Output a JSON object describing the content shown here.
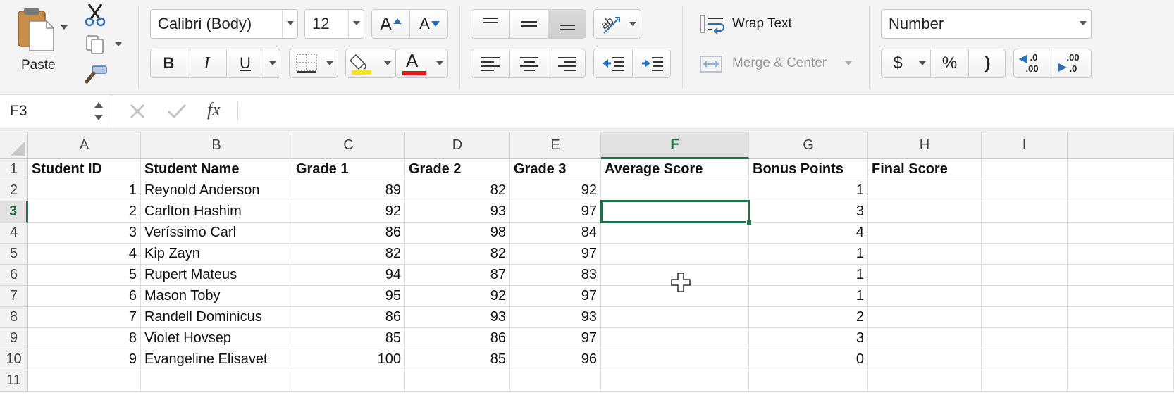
{
  "ribbon": {
    "clipboard": {
      "paste_label": "Paste"
    },
    "font": {
      "font_name": "Calibri (Body)",
      "font_size": "12",
      "bold_glyph": "B",
      "italic_glyph": "I",
      "underline_glyph": "U",
      "font_color_glyph": "A",
      "increase_size_glyph": "A",
      "decrease_size_glyph": "A",
      "fill_color": "#f5e61b",
      "font_color": "#e8161b"
    },
    "alignment": {
      "wrap_text_label": "Wrap Text",
      "merge_center_label": "Merge & Center"
    },
    "number": {
      "format": "Number",
      "currency_glyph": "$",
      "percent_glyph": "%",
      "comma_glyph": ")",
      "increase_decimal_top": ".0",
      "increase_decimal_bottom": ".00",
      "decrease_decimal_top": ".00",
      "decrease_decimal_bottom": ".0"
    }
  },
  "formula_bar": {
    "name_box": "F3",
    "fx_label": "fx",
    "formula": ""
  },
  "sheet": {
    "columns": [
      "A",
      "B",
      "C",
      "D",
      "E",
      "F",
      "G",
      "H",
      "I"
    ],
    "selected_column": "F",
    "row_numbers": [
      "1",
      "2",
      "3",
      "4",
      "5",
      "6",
      "7",
      "8",
      "9",
      "10",
      "11"
    ],
    "selected_row": "3",
    "headers": [
      "Student ID",
      "Student Name",
      "Grade 1",
      "Grade 2",
      "Grade 3",
      "Average Score",
      "Bonus Points",
      "Final Score"
    ],
    "rows": [
      [
        "1",
        "Reynold Anderson",
        "89",
        "82",
        "92",
        "",
        "1",
        ""
      ],
      [
        "2",
        "Carlton Hashim",
        "92",
        "93",
        "97",
        "",
        "3",
        ""
      ],
      [
        "3",
        "Veríssimo Carl",
        "86",
        "98",
        "84",
        "",
        "4",
        ""
      ],
      [
        "4",
        "Kip Zayn",
        "82",
        "82",
        "97",
        "",
        "1",
        ""
      ],
      [
        "5",
        "Rupert Mateus",
        "94",
        "87",
        "83",
        "",
        "1",
        ""
      ],
      [
        "6",
        "Mason Toby",
        "95",
        "92",
        "97",
        "",
        "1",
        ""
      ],
      [
        "7",
        "Randell Dominicus",
        "86",
        "93",
        "93",
        "",
        "2",
        ""
      ],
      [
        "8",
        "Violet Hovsep",
        "85",
        "86",
        "97",
        "",
        "3",
        ""
      ],
      [
        "9",
        "Evangeline Elisavet",
        "100",
        "85",
        "96",
        "",
        "0",
        ""
      ]
    ]
  },
  "colors": {
    "selection": "#1e7145",
    "ribbon_bg": "#f4f4f4"
  }
}
